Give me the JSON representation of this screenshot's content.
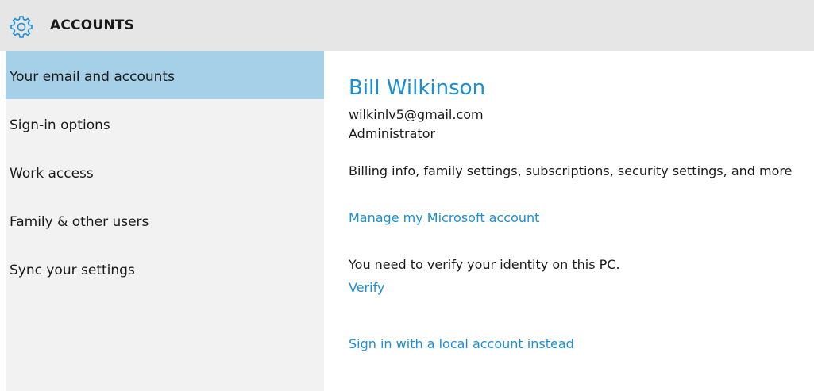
{
  "header": {
    "title": "ACCOUNTS",
    "icon": "gear-icon",
    "accent_color": "#1a8fd6"
  },
  "sidebar": {
    "items": [
      {
        "label": "Your email and accounts",
        "selected": true
      },
      {
        "label": "Sign-in options",
        "selected": false
      },
      {
        "label": "Work access",
        "selected": false
      },
      {
        "label": "Family & other users",
        "selected": false
      },
      {
        "label": "Sync your settings",
        "selected": false
      }
    ],
    "selected_color": "#a6cfe8"
  },
  "main": {
    "user_name": "Bill Wilkinson",
    "email": "wilkinlv5@gmail.com",
    "role": "Administrator",
    "billing_text": "Billing info, family settings, subscriptions, security settings, and more",
    "manage_link": "Manage my Microsoft account",
    "verify_text": "You need to verify your identity on this PC.",
    "verify_link": "Verify",
    "local_account_link": "Sign in with a local account instead"
  }
}
